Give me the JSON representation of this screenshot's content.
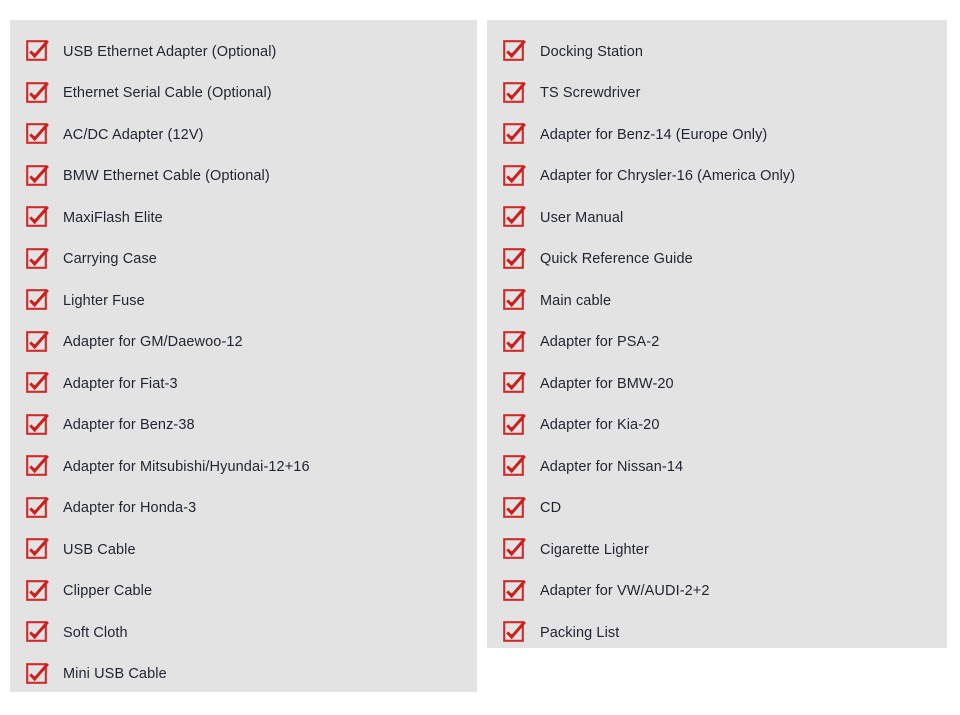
{
  "colors": {
    "panel_background": "#e3e3e3",
    "page_background": "#ffffff",
    "checkbox_border": "#cf2b2b",
    "checkmark": "#c9211e",
    "label_text": "#1f2430"
  },
  "checklist": {
    "icon_name": "checked-checkbox-icon",
    "left_column": {
      "items": [
        {
          "label": "USB Ethernet Adapter (Optional)"
        },
        {
          "label": "Ethernet Serial Cable (Optional)"
        },
        {
          "label": "AC/DC Adapter (12V)"
        },
        {
          "label": "BMW Ethernet Cable (Optional)"
        },
        {
          "label": "MaxiFlash Elite"
        },
        {
          "label": "Carrying Case"
        },
        {
          "label": "Lighter Fuse"
        },
        {
          "label": "Adapter for GM/Daewoo-12"
        },
        {
          "label": "Adapter for Fiat-3"
        },
        {
          "label": "Adapter for Benz-38"
        },
        {
          "label": "Adapter for Mitsubishi/Hyundai-12+16"
        },
        {
          "label": "Adapter for Honda-3"
        },
        {
          "label": "USB Cable"
        },
        {
          "label": "Clipper Cable"
        },
        {
          "label": "Soft Cloth"
        },
        {
          "label": "Mini USB Cable"
        }
      ]
    },
    "right_column": {
      "items": [
        {
          "label": "Docking Station"
        },
        {
          "label": "TS Screwdriver"
        },
        {
          "label": "Adapter for Benz-14 (Europe Only)"
        },
        {
          "label": "Adapter for Chrysler-16 (America Only)"
        },
        {
          "label": "User Manual"
        },
        {
          "label": "Quick Reference Guide"
        },
        {
          "label": "Main cable"
        },
        {
          "label": "Adapter for PSA-2"
        },
        {
          "label": "Adapter for BMW-20"
        },
        {
          "label": "Adapter for Kia-20"
        },
        {
          "label": "Adapter for Nissan-14"
        },
        {
          "label": "CD"
        },
        {
          "label": "Cigarette Lighter"
        },
        {
          "label": "Adapter for VW/AUDI-2+2"
        },
        {
          "label": "Packing List"
        }
      ]
    }
  }
}
